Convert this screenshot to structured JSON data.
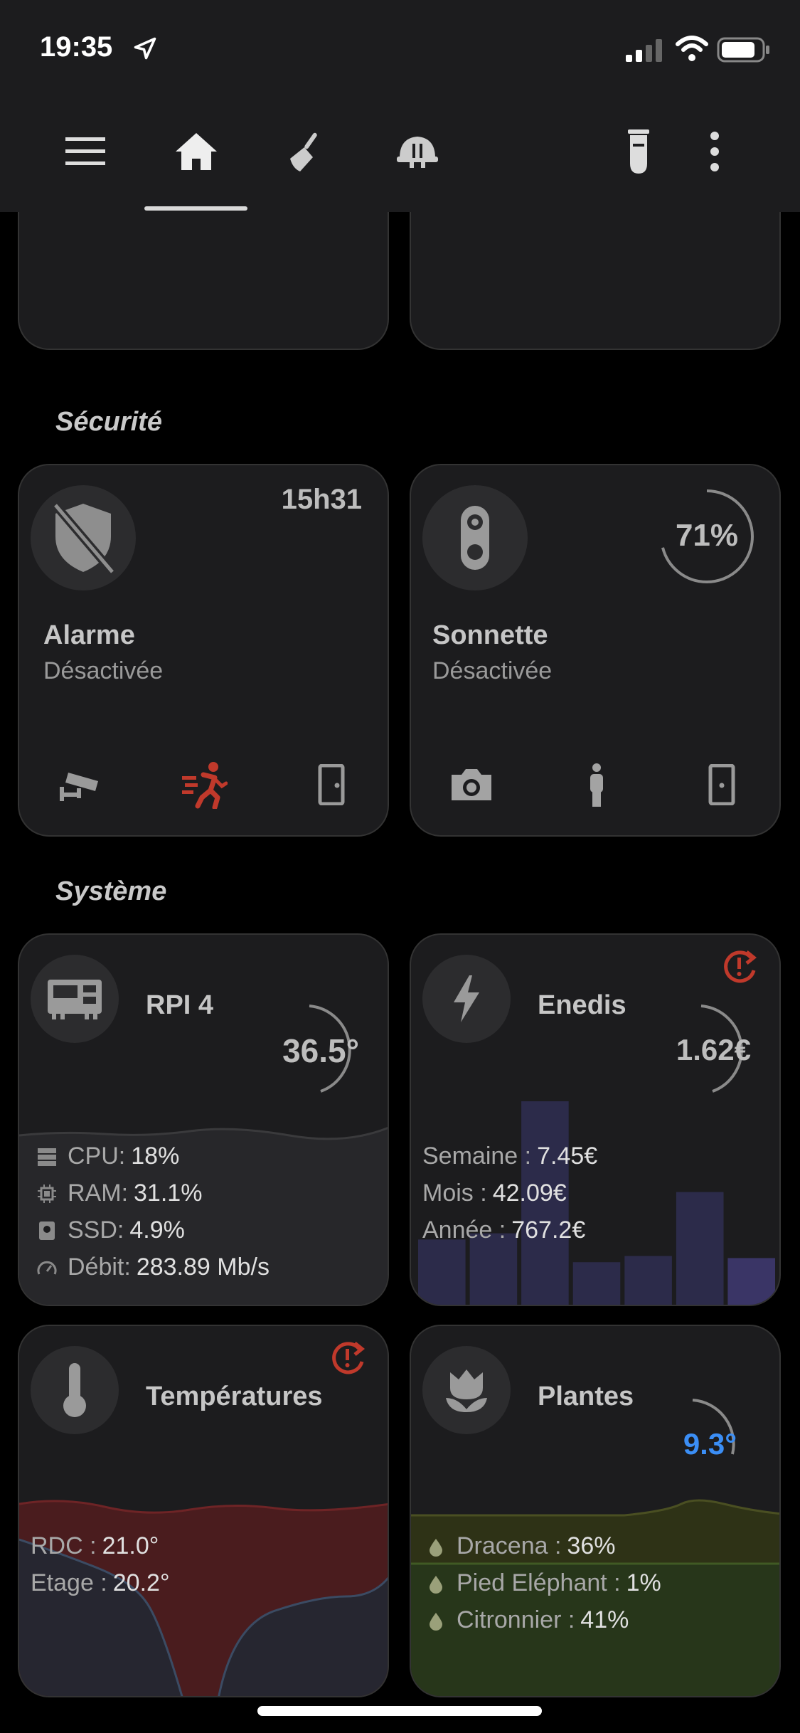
{
  "status_bar": {
    "time": "19:35"
  },
  "nav": {
    "items": [
      "menu-icon",
      "home-icon",
      "cleaning-icon",
      "helmet-icon"
    ],
    "right": [
      "test-tube-icon",
      "more-icon"
    ],
    "active": "home-icon"
  },
  "sections": {
    "security": "Sécurité",
    "system": "Système"
  },
  "alarm": {
    "time": "15h31",
    "title": "Alarme",
    "status": "Désactivée",
    "actions": [
      "cctv-icon",
      "running-person-icon",
      "door-icon"
    ],
    "accent": "#c0392b"
  },
  "doorbell": {
    "percent_label": "71%",
    "percent": 71,
    "title": "Sonnette",
    "status": "Désactivée",
    "actions": [
      "camera-icon",
      "person-icon",
      "door-icon"
    ]
  },
  "rpi": {
    "title": "RPI 4",
    "temp": "36.5°",
    "stats": [
      {
        "label": "CPU",
        "sep": " :",
        "value": "18%",
        "icon": "server-icon"
      },
      {
        "label": "RAM",
        "sep": " :",
        "value": "31.1%",
        "icon": "chip-icon"
      },
      {
        "label": "SSD",
        "sep": " :",
        "value": "4.9%",
        "icon": "disk-icon"
      },
      {
        "label": "Débit",
        "sep": ":",
        "value": "283.89 Mb/s",
        "icon": "gauge-icon"
      }
    ]
  },
  "enedis": {
    "title": "Enedis",
    "value": "1.62€",
    "stats": [
      {
        "label": "Semaine",
        "value": "7.45€"
      },
      {
        "label": "Mois",
        "value": "42.09€"
      },
      {
        "label": "Année",
        "value": "767.2€"
      }
    ],
    "bar_colors": [
      "#3a3566",
      "#2c2b4a"
    ],
    "bars": [
      0.33,
      0.36,
      1.0,
      0.22,
      0.25,
      0.56,
      0.24
    ]
  },
  "temperatures": {
    "title": "Températures",
    "stats": [
      {
        "label": "RDC",
        "value": "21.0°"
      },
      {
        "label": "Etage",
        "value": "20.2°"
      }
    ]
  },
  "plants": {
    "title": "Plantes",
    "value": "9.3°",
    "value_color": "#3b8ef5",
    "stats": [
      {
        "label": "Dracena",
        "value": "36%"
      },
      {
        "label": "Pied Eléphant",
        "value": "1%"
      },
      {
        "label": "Citronnier",
        "value": "41%"
      }
    ]
  }
}
